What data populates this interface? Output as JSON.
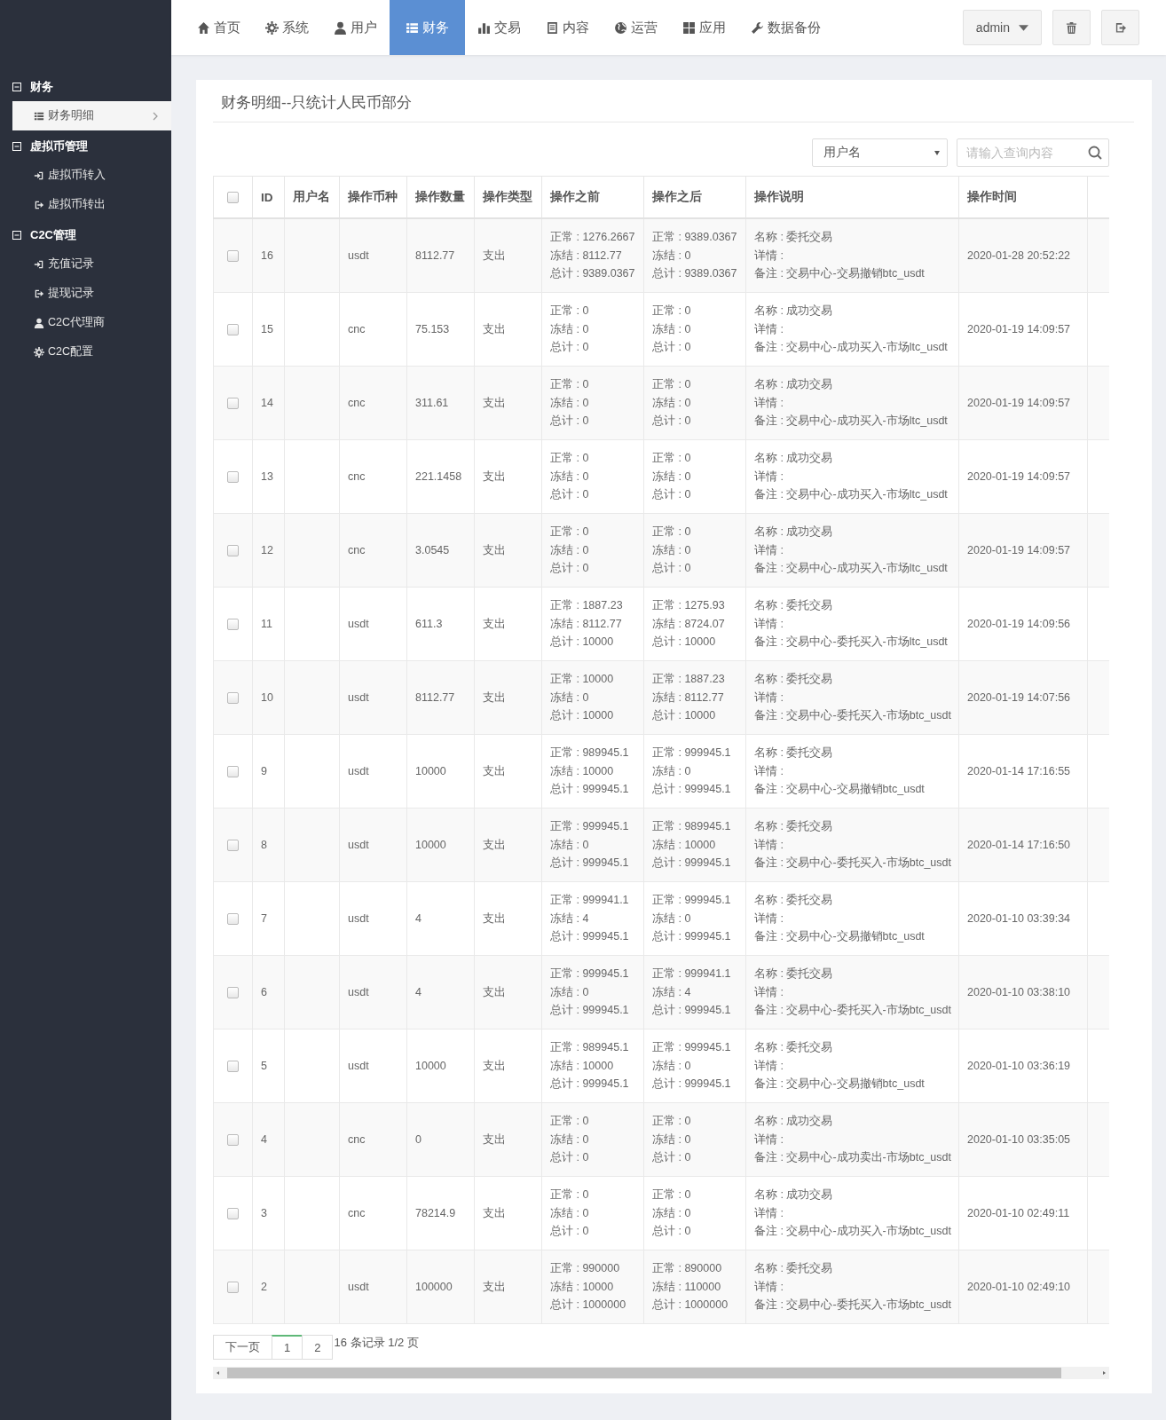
{
  "nav": {
    "items": [
      {
        "label": "首页",
        "selected": false
      },
      {
        "label": "系统",
        "selected": false
      },
      {
        "label": "用户",
        "selected": false
      },
      {
        "label": "财务",
        "selected": true
      },
      {
        "label": "交易",
        "selected": false
      },
      {
        "label": "内容",
        "selected": false
      },
      {
        "label": "运营",
        "selected": false
      },
      {
        "label": "应用",
        "selected": false
      },
      {
        "label": "数据备份",
        "selected": false
      }
    ],
    "user": "admin"
  },
  "sidebar": {
    "groups": [
      {
        "title": "财务",
        "items": [
          {
            "label": "财务明细",
            "selected": true
          }
        ]
      },
      {
        "title": "虚拟币管理",
        "items": [
          {
            "label": "虚拟币转入",
            "selected": false
          },
          {
            "label": "虚拟币转出",
            "selected": false
          }
        ]
      },
      {
        "title": "C2C管理",
        "items": [
          {
            "label": "充值记录",
            "selected": false
          },
          {
            "label": "提现记录",
            "selected": false
          },
          {
            "label": "C2C代理商",
            "selected": false
          },
          {
            "label": "C2C配置",
            "selected": false
          }
        ]
      }
    ]
  },
  "panel": {
    "title": "财务明细--只统计人民币部分",
    "filter": {
      "select": "用户名",
      "placeholder": "请输入查询内容"
    }
  },
  "table": {
    "select_all": {
      "checked": false
    },
    "columns": [
      "ID",
      "用户名",
      "操作币种",
      "操作数量",
      "操作类型",
      "操作之前",
      "操作之后",
      "操作说明",
      "操作时间"
    ],
    "rows": [
      {
        "checked": false,
        "id": "16",
        "user": "",
        "coin": "usdt",
        "amount": "8112.77",
        "type": "支出",
        "before": [
          "正常 : 1276.2667",
          "冻结 : 8112.77",
          "总计 : 9389.0367"
        ],
        "after": [
          "正常 : 9389.0367",
          "冻结 : 0",
          "总计 : 9389.0367"
        ],
        "desc": [
          "名称 : 委托交易",
          "详情 :",
          "备注 : 交易中心-交易撤销btc_usdt"
        ],
        "time": "2020-01-28 20:52:22"
      },
      {
        "checked": false,
        "id": "15",
        "user": "",
        "coin": "cnc",
        "amount": "75.153",
        "type": "支出",
        "before": [
          "正常 : 0",
          "冻结 : 0",
          "总计 : 0"
        ],
        "after": [
          "正常 : 0",
          "冻结 : 0",
          "总计 : 0"
        ],
        "desc": [
          "名称 : 成功交易",
          "详情 :",
          "备注 : 交易中心-成功买入-市场ltc_usdt"
        ],
        "time": "2020-01-19 14:09:57"
      },
      {
        "checked": false,
        "id": "14",
        "user": "",
        "coin": "cnc",
        "amount": "311.61",
        "type": "支出",
        "before": [
          "正常 : 0",
          "冻结 : 0",
          "总计 : 0"
        ],
        "after": [
          "正常 : 0",
          "冻结 : 0",
          "总计 : 0"
        ],
        "desc": [
          "名称 : 成功交易",
          "详情 :",
          "备注 : 交易中心-成功买入-市场ltc_usdt"
        ],
        "time": "2020-01-19 14:09:57"
      },
      {
        "checked": false,
        "id": "13",
        "user": "",
        "coin": "cnc",
        "amount": "221.1458",
        "type": "支出",
        "before": [
          "正常 : 0",
          "冻结 : 0",
          "总计 : 0"
        ],
        "after": [
          "正常 : 0",
          "冻结 : 0",
          "总计 : 0"
        ],
        "desc": [
          "名称 : 成功交易",
          "详情 :",
          "备注 : 交易中心-成功买入-市场ltc_usdt"
        ],
        "time": "2020-01-19 14:09:57"
      },
      {
        "checked": false,
        "id": "12",
        "user": "",
        "coin": "cnc",
        "amount": "3.0545",
        "type": "支出",
        "before": [
          "正常 : 0",
          "冻结 : 0",
          "总计 : 0"
        ],
        "after": [
          "正常 : 0",
          "冻结 : 0",
          "总计 : 0"
        ],
        "desc": [
          "名称 : 成功交易",
          "详情 :",
          "备注 : 交易中心-成功买入-市场ltc_usdt"
        ],
        "time": "2020-01-19 14:09:57"
      },
      {
        "checked": false,
        "id": "11",
        "user": "",
        "coin": "usdt",
        "amount": "611.3",
        "type": "支出",
        "before": [
          "正常 : 1887.23",
          "冻结 : 8112.77",
          "总计 : 10000"
        ],
        "after": [
          "正常 : 1275.93",
          "冻结 : 8724.07",
          "总计 : 10000"
        ],
        "desc": [
          "名称 : 委托交易",
          "详情 :",
          "备注 : 交易中心-委托买入-市场ltc_usdt"
        ],
        "time": "2020-01-19 14:09:56"
      },
      {
        "checked": false,
        "id": "10",
        "user": "",
        "coin": "usdt",
        "amount": "8112.77",
        "type": "支出",
        "before": [
          "正常 : 10000",
          "冻结 : 0",
          "总计 : 10000"
        ],
        "after": [
          "正常 : 1887.23",
          "冻结 : 8112.77",
          "总计 : 10000"
        ],
        "desc": [
          "名称 : 委托交易",
          "详情 :",
          "备注 : 交易中心-委托买入-市场btc_usdt"
        ],
        "time": "2020-01-19 14:07:56"
      },
      {
        "checked": false,
        "id": "9",
        "user": "",
        "coin": "usdt",
        "amount": "10000",
        "type": "支出",
        "before": [
          "正常 : 989945.1",
          "冻结 : 10000",
          "总计 : 999945.1"
        ],
        "after": [
          "正常 : 999945.1",
          "冻结 : 0",
          "总计 : 999945.1"
        ],
        "desc": [
          "名称 : 委托交易",
          "详情 :",
          "备注 : 交易中心-交易撤销btc_usdt"
        ],
        "time": "2020-01-14 17:16:55"
      },
      {
        "checked": false,
        "id": "8",
        "user": "",
        "coin": "usdt",
        "amount": "10000",
        "type": "支出",
        "before": [
          "正常 : 999945.1",
          "冻结 : 0",
          "总计 : 999945.1"
        ],
        "after": [
          "正常 : 989945.1",
          "冻结 : 10000",
          "总计 : 999945.1"
        ],
        "desc": [
          "名称 : 委托交易",
          "详情 :",
          "备注 : 交易中心-委托买入-市场btc_usdt"
        ],
        "time": "2020-01-14 17:16:50"
      },
      {
        "checked": false,
        "id": "7",
        "user": "",
        "coin": "usdt",
        "amount": "4",
        "type": "支出",
        "before": [
          "正常 : 999941.1",
          "冻结 : 4",
          "总计 : 999945.1"
        ],
        "after": [
          "正常 : 999945.1",
          "冻结 : 0",
          "总计 : 999945.1"
        ],
        "desc": [
          "名称 : 委托交易",
          "详情 :",
          "备注 : 交易中心-交易撤销btc_usdt"
        ],
        "time": "2020-01-10 03:39:34"
      },
      {
        "checked": false,
        "id": "6",
        "user": "",
        "coin": "usdt",
        "amount": "4",
        "type": "支出",
        "before": [
          "正常 : 999945.1",
          "冻结 : 0",
          "总计 : 999945.1"
        ],
        "after": [
          "正常 : 999941.1",
          "冻结 : 4",
          "总计 : 999945.1"
        ],
        "desc": [
          "名称 : 委托交易",
          "详情 :",
          "备注 : 交易中心-委托买入-市场btc_usdt"
        ],
        "time": "2020-01-10 03:38:10"
      },
      {
        "checked": false,
        "id": "5",
        "user": "",
        "coin": "usdt",
        "amount": "10000",
        "type": "支出",
        "before": [
          "正常 : 989945.1",
          "冻结 : 10000",
          "总计 : 999945.1"
        ],
        "after": [
          "正常 : 999945.1",
          "冻结 : 0",
          "总计 : 999945.1"
        ],
        "desc": [
          "名称 : 委托交易",
          "详情 :",
          "备注 : 交易中心-交易撤销btc_usdt"
        ],
        "time": "2020-01-10 03:36:19"
      },
      {
        "checked": false,
        "id": "4",
        "user": "",
        "coin": "cnc",
        "amount": "0",
        "type": "支出",
        "before": [
          "正常 : 0",
          "冻结 : 0",
          "总计 : 0"
        ],
        "after": [
          "正常 : 0",
          "冻结 : 0",
          "总计 : 0"
        ],
        "desc": [
          "名称 : 成功交易",
          "详情 :",
          "备注 : 交易中心-成功卖出-市场btc_usdt"
        ],
        "time": "2020-01-10 03:35:05"
      },
      {
        "checked": false,
        "id": "3",
        "user": "",
        "coin": "cnc",
        "amount": "78214.9",
        "type": "支出",
        "before": [
          "正常 : 0",
          "冻结 : 0",
          "总计 : 0"
        ],
        "after": [
          "正常 : 0",
          "冻结 : 0",
          "总计 : 0"
        ],
        "desc": [
          "名称 : 成功交易",
          "详情 :",
          "备注 : 交易中心-成功买入-市场btc_usdt"
        ],
        "time": "2020-01-10 02:49:11"
      },
      {
        "checked": false,
        "id": "2",
        "user": "",
        "coin": "usdt",
        "amount": "100000",
        "type": "支出",
        "before": [
          "正常 : 990000",
          "冻结 : 10000",
          "总计 : 1000000"
        ],
        "after": [
          "正常 : 890000",
          "冻结 : 110000",
          "总计 : 1000000"
        ],
        "desc": [
          "名称 : 委托交易",
          "详情 :",
          "备注 : 交易中心-委托买入-市场btc_usdt"
        ],
        "time": "2020-01-10 02:49:10"
      }
    ]
  },
  "pagination": {
    "next": "下一页",
    "pages": [
      {
        "label": "1",
        "selected": true
      },
      {
        "label": "2",
        "selected": false
      }
    ],
    "summary": "16 条记录 1/2 页"
  }
}
